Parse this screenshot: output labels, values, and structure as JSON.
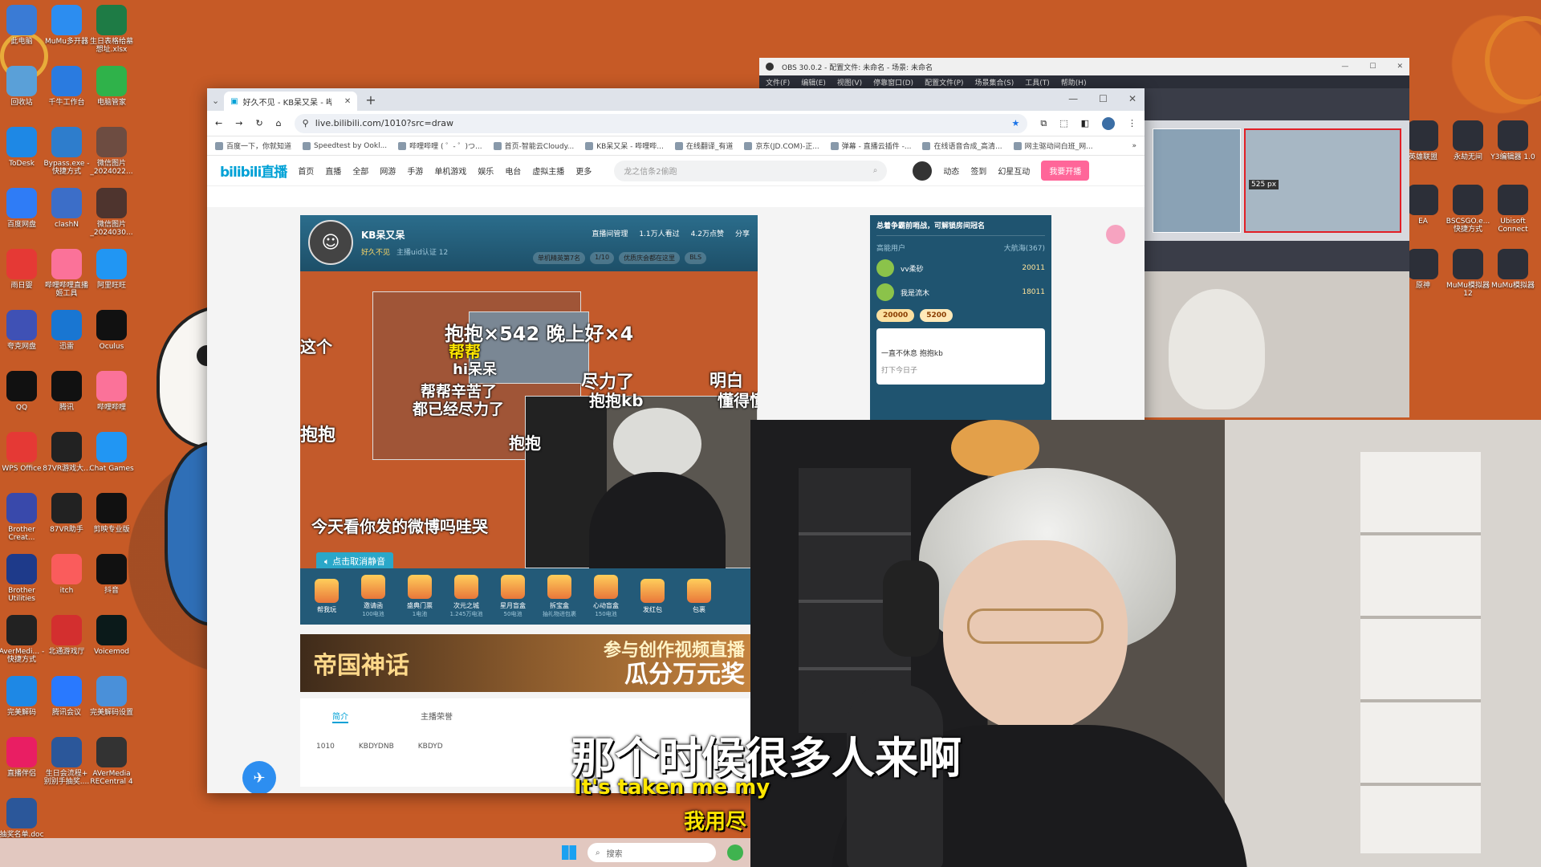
{
  "desktop_icons": [
    {
      "label": "此电脑",
      "icon": "computer-icon",
      "color": "#3a7bd5"
    },
    {
      "label": "MuMu多开器",
      "icon": "mumu-icon",
      "color": "#2c8df0"
    },
    {
      "label": "生日表格给墓想址.xlsx",
      "icon": "excel-icon",
      "color": "#1e7b45"
    },
    {
      "label": "回收站",
      "icon": "recycle-bin-icon",
      "color": "#5aa0d8"
    },
    {
      "label": "千牛工作台",
      "icon": "qianniu-icon",
      "color": "#2a7be0"
    },
    {
      "label": "电脑管家",
      "icon": "pc-manager-icon",
      "color": "#2fb24a"
    },
    {
      "label": "ToDesk",
      "icon": "todesk-icon",
      "color": "#1e88e5"
    },
    {
      "label": "Bypass.exe - 快捷方式",
      "icon": "bypass-icon",
      "color": "#2e7dcc"
    },
    {
      "label": "微信图片_2024022...",
      "icon": "image-icon",
      "color": "#6d4c41"
    },
    {
      "label": "百度网盘",
      "icon": "baidu-pan-icon",
      "color": "#2f7cf6"
    },
    {
      "label": "clashN",
      "icon": "clash-icon",
      "color": "#3c6ec8"
    },
    {
      "label": "微信图片_2024030...",
      "icon": "image-icon",
      "color": "#4e342e"
    },
    {
      "label": "雨日婴",
      "icon": "app-icon",
      "color": "#e53935"
    },
    {
      "label": "哔哩哔哩直播姬工具",
      "icon": "bilibili-live-icon",
      "color": "#fb7299"
    },
    {
      "label": "阿里旺旺",
      "icon": "aliwangwang-icon",
      "color": "#2196f3"
    },
    {
      "label": "夸克网盘",
      "icon": "quark-icon",
      "color": "#3f51b5"
    },
    {
      "label": "迅雷",
      "icon": "xunlei-icon",
      "color": "#1976d2"
    },
    {
      "label": "Oculus",
      "icon": "oculus-icon",
      "color": "#111111"
    },
    {
      "label": "QQ",
      "icon": "qq-icon",
      "color": "#111111"
    },
    {
      "label": "腾讯",
      "icon": "tencent-icon",
      "color": "#111111"
    },
    {
      "label": "哔哩哔哩",
      "icon": "bilibili-icon",
      "color": "#fb7299"
    },
    {
      "label": "WPS Office",
      "icon": "wps-icon",
      "color": "#e53935"
    },
    {
      "label": "87VR游戏大...",
      "icon": "vr-icon",
      "color": "#222222"
    },
    {
      "label": "Chat Games",
      "icon": "chat-games-icon",
      "color": "#2196f3"
    },
    {
      "label": "Brother Creat...",
      "icon": "brother-icon",
      "color": "#3949ab"
    },
    {
      "label": "87VR助手",
      "icon": "vr-helper-icon",
      "color": "#222222"
    },
    {
      "label": "剪映专业版",
      "icon": "jianying-icon",
      "color": "#111111"
    },
    {
      "label": "Brother Utilities",
      "icon": "brother-utilities-icon",
      "color": "#1e3a8a"
    },
    {
      "label": "itch",
      "icon": "itch-icon",
      "color": "#fa5c5c"
    },
    {
      "label": "抖音",
      "icon": "douyin-icon",
      "color": "#111111"
    },
    {
      "label": "AverMedi... - 快捷方式",
      "icon": "avermedia-icon",
      "color": "#222222"
    },
    {
      "label": "北通游戏厅",
      "icon": "betop-icon",
      "color": "#d32f2f"
    },
    {
      "label": "Voicemod",
      "icon": "voicemod-icon",
      "color": "#0b1a1a"
    },
    {
      "label": "完美解码",
      "icon": "potplayer-icon",
      "color": "#1e88e5"
    },
    {
      "label": "腾讯会议",
      "icon": "tencent-meeting-icon",
      "color": "#2979ff"
    },
    {
      "label": "完美解码设置",
      "icon": "settings-icon",
      "color": "#4a90d9"
    },
    {
      "label": "直播伴侣",
      "icon": "live-companion-icon",
      "color": "#e91e63"
    },
    {
      "label": "生日会流程+ 别别手抽奖....",
      "icon": "word-icon",
      "color": "#2b579a"
    },
    {
      "label": "AVerMedia RECentral 4",
      "icon": "recentral-icon",
      "color": "#333333"
    },
    {
      "label": "抽奖名单.doc",
      "icon": "word-icon",
      "color": "#2b579a"
    }
  ],
  "right_icons": [
    {
      "label": "英雄联盟",
      "icon": "lol-icon"
    },
    {
      "label": "永劫无间",
      "icon": "naraka-icon"
    },
    {
      "label": "Y3编辑器 1.0",
      "icon": "y3-icon"
    },
    {
      "label": "EA",
      "icon": "ea-icon"
    },
    {
      "label": "BSCSGO.e... 快捷方式",
      "icon": "csgo-icon"
    },
    {
      "label": "Ubisoft Connect",
      "icon": "ubisoft-icon"
    },
    {
      "label": "原神",
      "icon": "genshin-icon"
    },
    {
      "label": "MuMu模拟器12",
      "icon": "mumu-icon"
    },
    {
      "label": "MuMu模拟器",
      "icon": "mumu-icon"
    }
  ],
  "browser": {
    "tab_title": "好久不见 - KB呆又呆 - 哔哩哔哩直播",
    "url": "live.bilibili.com/1010?src=draw",
    "bookmarks": [
      "百度一下，你就知道",
      "Speedtest by Ookl...",
      "哔哩哔哩 ( ゜- ゜)つ...",
      "首页-智能云Cloudy...",
      "KB呆又呆 - 哔哩哔...",
      "在线翻译_有道",
      "京东(JD.COM)-正...",
      "弹幕 - 直播云插件 -...",
      "在线语音合成_高清...",
      "网主驱动间白班_网..."
    ],
    "nav": {
      "logo": "bilibili直播",
      "items": [
        "首页",
        "直播",
        "全部",
        "网游",
        "手游",
        "单机游戏",
        "娱乐",
        "电台",
        "虚拟主播",
        "更多"
      ],
      "search_placeholder": "龙之信条2偷跑",
      "right": [
        "动态",
        "签到",
        "幻星互动"
      ],
      "start_button": "我要开播"
    }
  },
  "stream": {
    "streamer": "KB呆又呆",
    "title": "好久不见",
    "host_tag": "主播uid认证 12",
    "meta": [
      "直播间管理",
      "1.1万人看过",
      "4.2万点赞",
      "分享"
    ],
    "badges": [
      "单机精英第7名",
      "1/10",
      "优质庆会都在这里",
      "BLS"
    ],
    "danmaku": [
      {
        "text": "抱抱×542 晚上好×4",
        "style": "white"
      },
      {
        "text": "帮帮",
        "style": "yellow"
      },
      {
        "text": "hi呆呆",
        "style": "white"
      },
      {
        "text": "这个",
        "style": "white"
      },
      {
        "text": "帮帮辛苦了",
        "style": "white"
      },
      {
        "text": "都已经尽力了",
        "style": "white"
      },
      {
        "text": "尽力了",
        "style": "white"
      },
      {
        "text": "抱抱kb",
        "style": "white"
      },
      {
        "text": "抱抱",
        "style": "white"
      },
      {
        "text": "明白",
        "style": "white"
      },
      {
        "text": "懂得懂得",
        "style": "white"
      },
      {
        "text": "抱抱",
        "style": "white"
      },
      {
        "text": "今天看你发的微博吗哇哭",
        "style": "white"
      }
    ],
    "unmute_label": "点击取消静音",
    "gifts": [
      {
        "name": "帮我玩",
        "price": ""
      },
      {
        "name": "邀请函",
        "price": "100电池"
      },
      {
        "name": "盛典门票",
        "price": "1电池"
      },
      {
        "name": "次元之城",
        "price": "1.245万电池"
      },
      {
        "name": "星月盲盒",
        "price": "50电池"
      },
      {
        "name": "拆宝盒",
        "price": "抽礼物进包裹"
      },
      {
        "name": "心动盲盒",
        "price": "150电池"
      },
      {
        "name": "发红包",
        "price": ""
      },
      {
        "name": "包裹",
        "price": ""
      }
    ],
    "banner_left": "帝国神话",
    "banner_right_1": "参与创作视频直播",
    "banner_right_2": "瓜分万元奖",
    "profile_tabs": [
      "简介",
      "主播荣誉"
    ],
    "tags": [
      "1010",
      "KBDYDNB",
      "KBDYD"
    ]
  },
  "rank": {
    "title": "总着争霸前哨战，可解锁房间冠名",
    "header_left": "高能用户",
    "header_right": "大航海(367)",
    "rows": [
      {
        "name": "vv柔砂",
        "value": "20011"
      },
      {
        "name": "我是流木",
        "value": "18011"
      }
    ],
    "pill_1": "20000",
    "pill_2": "5200",
    "chat_1": "一直不休息 抱抱kb",
    "chat_2": "打下今日子"
  },
  "obs": {
    "title": "OBS 30.0.2 - 配置文件: 未命名 - 场景: 未命名",
    "menu": [
      "文件(F)",
      "编辑(E)",
      "视图(V)",
      "停靠窗口(D)",
      "配置文件(P)",
      "场景集合(S)",
      "工具(T)",
      "帮助(H)"
    ],
    "size_readout": "525 px"
  },
  "subtitles": {
    "zh": "那个时候很多人来啊",
    "en": "It's taken me my",
    "zh2": "我用尽"
  },
  "taskbar": {
    "search_placeholder": "搜索"
  }
}
